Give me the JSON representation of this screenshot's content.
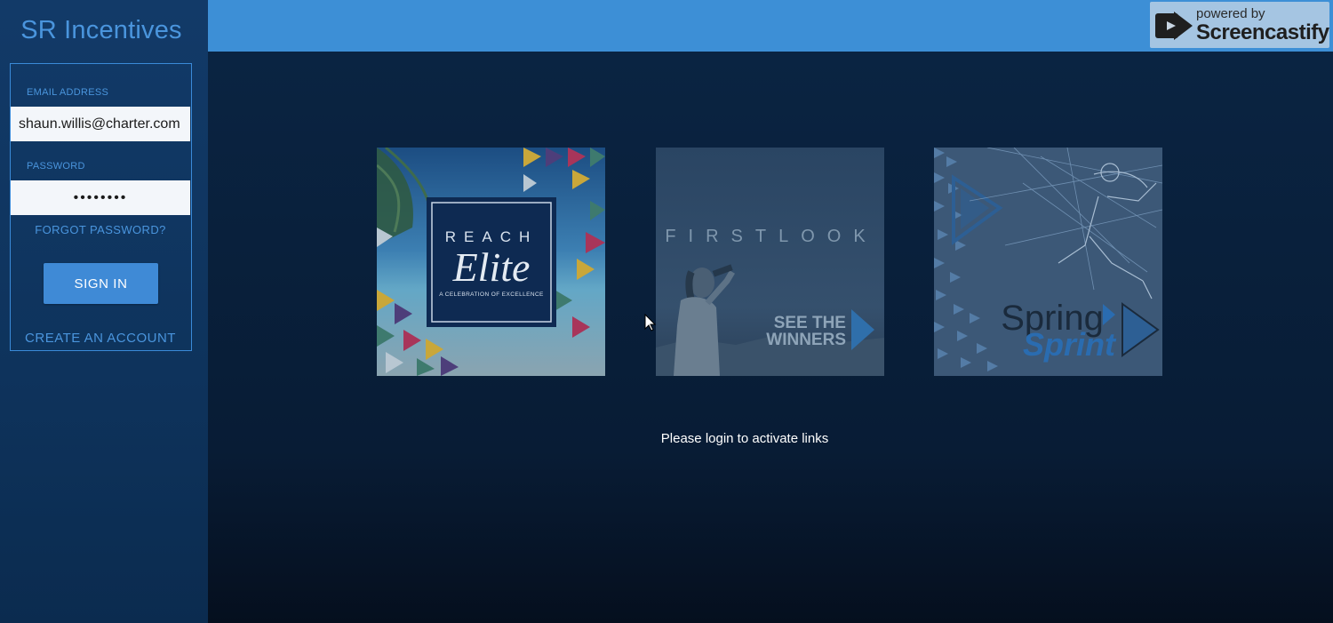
{
  "sidebar": {
    "brand": "SR Incentives",
    "email_label": "EMAIL ADDRESS",
    "email_value": "shaun.willis@charter.com",
    "password_label": "PASSWORD",
    "password_value": "••••••••",
    "forgot_label": "FORGOT PASSWORD?",
    "signin_label": "SIGN IN",
    "create_label": "CREATE AN ACCOUNT"
  },
  "watermark": {
    "small": "powered by",
    "big": "Screencastify"
  },
  "tiles": [
    {
      "name": "reach-elite",
      "line1": "REACH",
      "line2": "Elite",
      "tagline": "A CELEBRATION OF EXCELLENCE"
    },
    {
      "name": "first-look",
      "title": "FIRSTLOOK",
      "cta_line1": "SEE THE",
      "cta_line2": "WINNERS"
    },
    {
      "name": "spring-sprint",
      "line1": "Spring",
      "line2": "Sprint"
    }
  ],
  "main": {
    "notice": "Please login to activate links"
  },
  "colors": {
    "accent": "#3d8fd6",
    "sidebar_bg": "#123a68",
    "main_bg": "#0a2442"
  }
}
